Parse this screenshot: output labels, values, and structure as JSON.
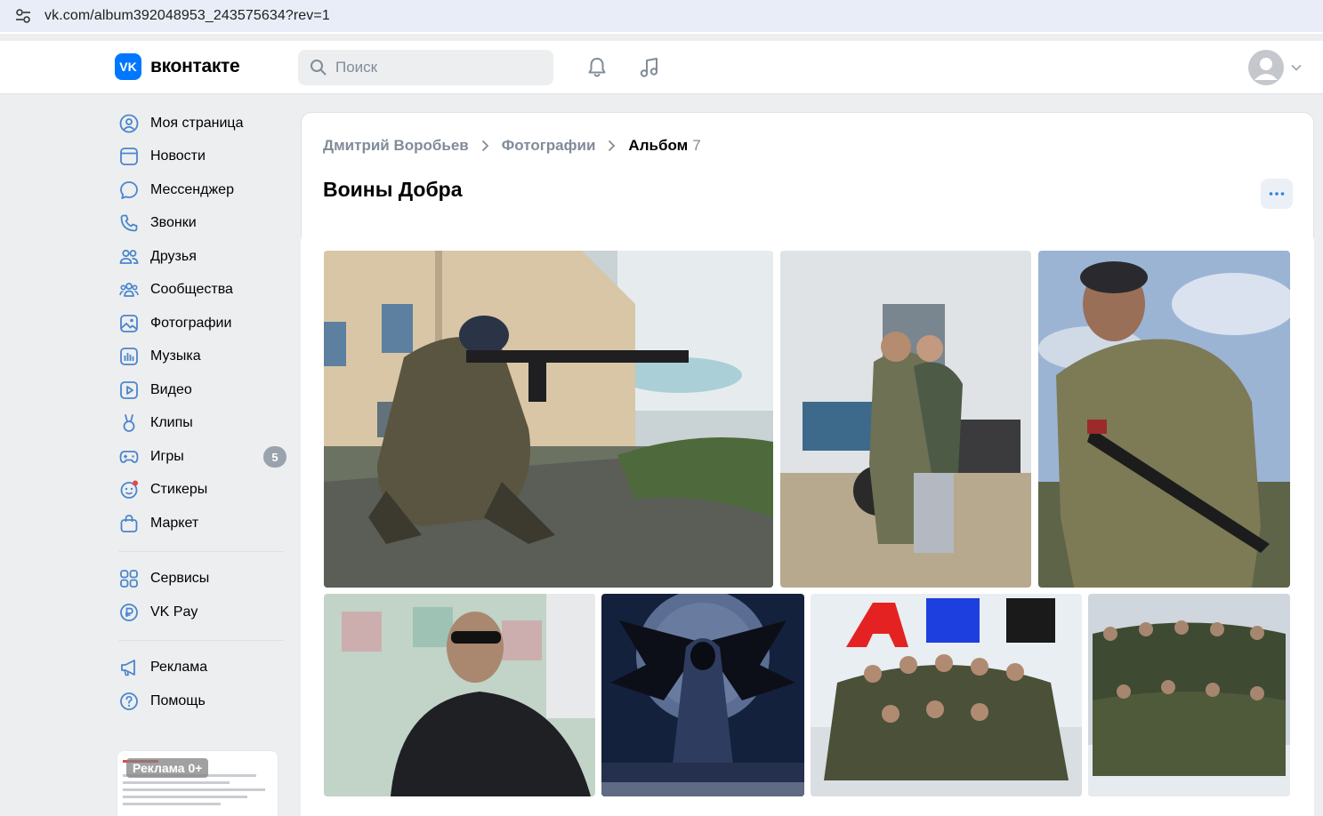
{
  "browser": {
    "url": "vk.com/album392048953_243575634?rev=1"
  },
  "header": {
    "logo_mark": "VK",
    "logo_text": "вконтакте",
    "search_placeholder": "Поиск"
  },
  "sidebar": {
    "items": [
      {
        "label": "Моя страница",
        "icon": "user-circle-icon"
      },
      {
        "label": "Новости",
        "icon": "newsfeed-icon"
      },
      {
        "label": "Мессенджер",
        "icon": "message-icon"
      },
      {
        "label": "Звонки",
        "icon": "phone-icon"
      },
      {
        "label": "Друзья",
        "icon": "friends-icon"
      },
      {
        "label": "Сообщества",
        "icon": "communities-icon"
      },
      {
        "label": "Фотографии",
        "icon": "photos-icon"
      },
      {
        "label": "Музыка",
        "icon": "music-icon"
      },
      {
        "label": "Видео",
        "icon": "video-icon"
      },
      {
        "label": "Клипы",
        "icon": "clips-icon"
      },
      {
        "label": "Игры",
        "icon": "games-icon",
        "badge": "5"
      },
      {
        "label": "Стикеры",
        "icon": "stickers-icon"
      },
      {
        "label": "Маркет",
        "icon": "market-icon"
      }
    ],
    "services": [
      {
        "label": "Сервисы",
        "icon": "services-icon"
      },
      {
        "label": "VK Pay",
        "icon": "vkpay-icon"
      }
    ],
    "footer": [
      {
        "label": "Реклама",
        "icon": "megaphone-icon"
      },
      {
        "label": "Помощь",
        "icon": "help-icon"
      }
    ],
    "ad_label": "Реклама 0+"
  },
  "album": {
    "breadcrumb": {
      "owner": "Дмитрий Воробьев",
      "section": "Фотографии",
      "current": "Альбом",
      "count": "7"
    },
    "title": "Воины Добра"
  },
  "colors": {
    "accent": "#0077ff",
    "link": "#818c99",
    "bg": "#edeef0"
  }
}
